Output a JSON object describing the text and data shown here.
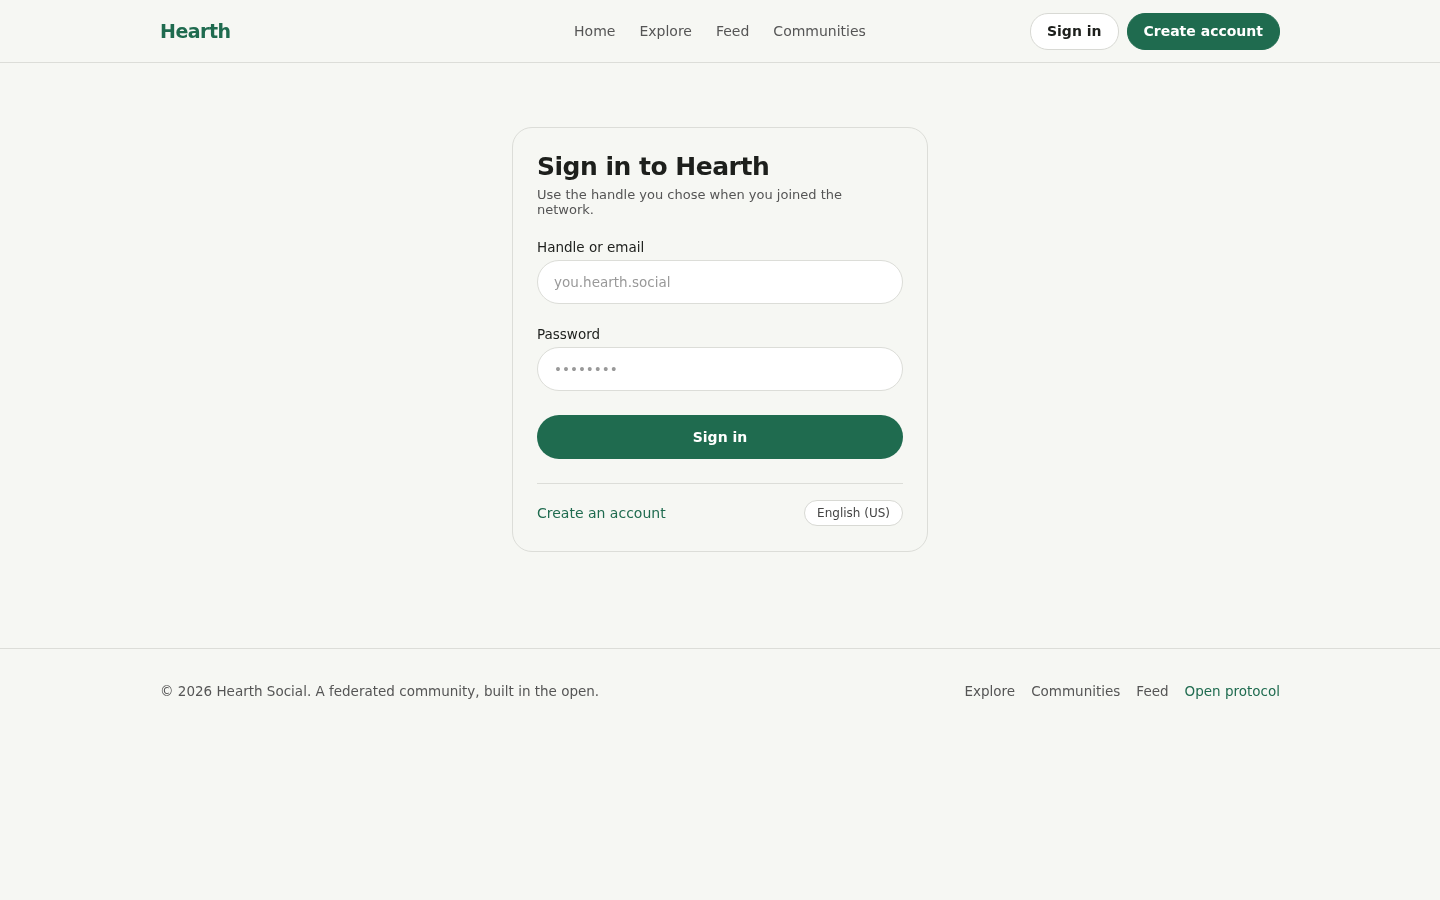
{
  "header": {
    "logo": "Hearth",
    "nav": [
      "Home",
      "Explore",
      "Feed",
      "Communities"
    ],
    "actions": [
      {
        "label": "Sign in",
        "kind": "outline"
      },
      {
        "label": "Create account",
        "kind": "primary"
      }
    ]
  },
  "card": {
    "title": "Sign in to Hearth",
    "subtitle": "Use the handle you chose when you joined the network.",
    "fields": [
      {
        "label": "Handle or email",
        "placeholder": "you.hearth.social"
      },
      {
        "label": "Password",
        "placeholder": "••••••••"
      }
    ],
    "submit": "Sign in",
    "create_link": "Create an account",
    "language": "English (US)"
  },
  "footer": {
    "copyright": "© 2026 Hearth Social. A federated community, built in the open.",
    "links": [
      {
        "label": "Explore",
        "kind": "plain"
      },
      {
        "label": "Communities",
        "kind": "plain"
      },
      {
        "label": "Feed",
        "kind": "plain"
      },
      {
        "label": "Open protocol",
        "kind": "accent"
      }
    ]
  }
}
